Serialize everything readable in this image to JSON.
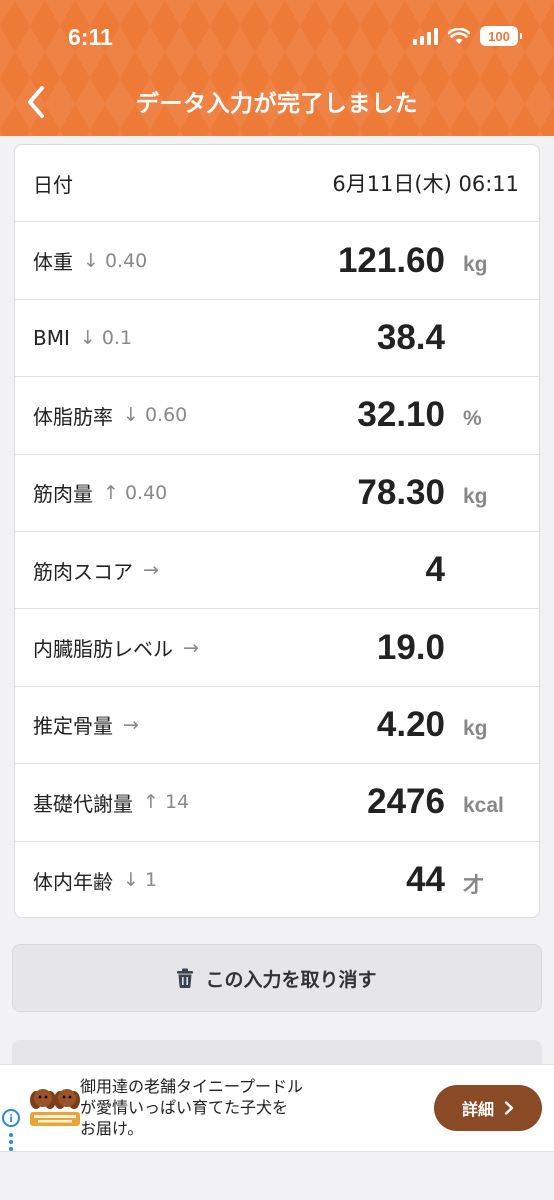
{
  "status_bar": {
    "time": "6:11",
    "battery": "100"
  },
  "header": {
    "title": "データ入力が完了しました"
  },
  "date_row": {
    "label": "日付",
    "value": "6月11日(木) 06:11"
  },
  "metrics": [
    {
      "label": "体重",
      "delta": "↓ 0.40",
      "value": "121.60",
      "unit": "kg"
    },
    {
      "label": "BMI",
      "delta": "↓ 0.1",
      "value": "38.4",
      "unit": ""
    },
    {
      "label": "体脂肪率",
      "delta": "↓ 0.60",
      "value": "32.10",
      "unit": "%"
    },
    {
      "label": "筋肉量",
      "delta": "↑ 0.40",
      "value": "78.30",
      "unit": "kg"
    },
    {
      "label": "筋肉スコア",
      "delta": "→",
      "value": "4",
      "unit": ""
    },
    {
      "label": "内臓脂肪レベル",
      "delta": "→",
      "value": "19.0",
      "unit": ""
    },
    {
      "label": "推定骨量",
      "delta": "→",
      "value": "4.20",
      "unit": "kg"
    },
    {
      "label": "基礎代謝量",
      "delta": "↑ 14",
      "value": "2476",
      "unit": "kcal"
    },
    {
      "label": "体内年齢",
      "delta": "↓ 1",
      "value": "44",
      "unit": "才"
    }
  ],
  "actions": {
    "cancel_label": "この入力を取り消す"
  },
  "ad": {
    "lines": [
      "御用達の老舗タイニープードル",
      "が愛情いっぱい育てた子犬を",
      "お届け。"
    ],
    "button_label": "詳細"
  },
  "colors": {
    "header": "#ee7a38",
    "ad_button": "#8a4a26"
  }
}
